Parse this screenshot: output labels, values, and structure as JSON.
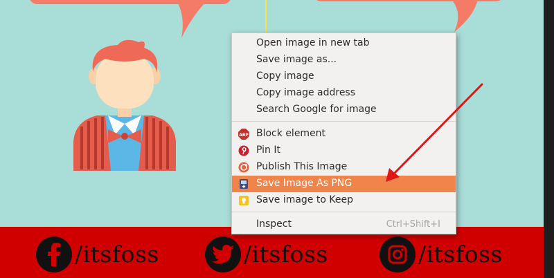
{
  "context_menu": {
    "items_top": [
      "Open image in new tab",
      "Save image as...",
      "Copy image",
      "Copy image address",
      "Search Google for image"
    ],
    "items_ext": [
      {
        "label": "Block element",
        "icon": "adblock-icon"
      },
      {
        "label": "Pin It",
        "icon": "pinterest-icon"
      },
      {
        "label": "Publish This Image",
        "icon": "publish-icon"
      },
      {
        "label": "Save Image As PNG",
        "icon": "save-png-icon",
        "highlighted": true
      },
      {
        "label": "Save image to Keep",
        "icon": "keep-icon"
      }
    ],
    "inspect": {
      "label": "Inspect",
      "shortcut": "Ctrl+Shift+I"
    }
  },
  "footer": {
    "socials": [
      {
        "icon": "facebook-icon",
        "handle": "/itsfoss"
      },
      {
        "icon": "twitter-icon",
        "handle": "/itsfoss"
      },
      {
        "icon": "instagram-icon",
        "handle": "/itsfoss"
      }
    ]
  },
  "colors": {
    "background": "#a9ddd8",
    "footer": "#d10000",
    "bubble": "#f47c67",
    "menu_highlight": "#f0844b",
    "arrow": "#e01515"
  }
}
